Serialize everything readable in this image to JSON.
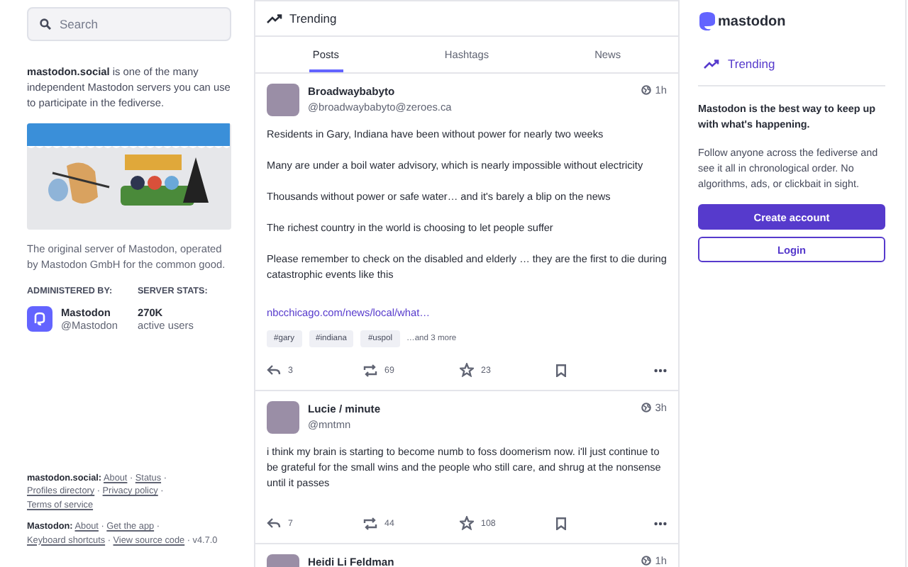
{
  "search": {
    "placeholder": "Search"
  },
  "about": {
    "intro": "**mastodon.social** is one of the many independent Mastodon servers you can use to participate in the fediverse.",
    "description": "The original server of Mastodon, operated by Mastodon GmbH for the common good.",
    "admin_label": "ADMINISTERED BY:",
    "admin": {
      "name": "Mastodon",
      "handle": "@Mastodon"
    },
    "stats_label": "SERVER STATS:",
    "stats": {
      "value": "270K",
      "label": "active users"
    }
  },
  "footer": {
    "separator": "·",
    "groups": [
      {
        "label": "mastodon.social:",
        "links": [
          "About",
          "Status",
          "Profiles directory",
          "Privacy policy",
          "Terms of service"
        ]
      },
      {
        "label": "Mastodon:",
        "links": [
          "About",
          "Get the app",
          "Keyboard shortcuts",
          "View source code"
        ],
        "version": "v4.7.0"
      }
    ]
  },
  "feed": {
    "title": "Trending",
    "tabs": [
      {
        "label": "Posts",
        "selected": true
      },
      {
        "label": "Hashtags",
        "selected": false
      },
      {
        "label": "News",
        "selected": false
      }
    ],
    "posts": [
      {
        "name": "Broadwaybabyto",
        "handle": "@broadwaybabyto@zeroes.ca",
        "time": "1h",
        "paragraphs": [
          "Residents in Gary, Indiana have been without power for nearly two weeks",
          "Many are under a boil water advisory, which is nearly impossible without electricity",
          "Thousands without power or safe water… and it's barely a blip on the news",
          "The richest country in the world is choosing to let people suffer",
          "Please remember to check on the disabled and elderly … they are the first to die during catastrophic events like this"
        ],
        "link": "nbcchicago.com/news/local/what…",
        "tags": [
          "#gary",
          "#indiana",
          "#uspol"
        ],
        "more_tags": "…and 3 more",
        "replies": "3",
        "boosts": "69",
        "favourites": "23"
      },
      {
        "name": "Lucie / minute",
        "handle": "@mntmn",
        "time": "3h",
        "paragraphs": [
          "i think my brain is starting to become numb to foss doomerism now. i'll just continue to be grateful for the small wins and the people who still care, and shrug at the nonsense until it passes"
        ],
        "replies": "7",
        "boosts": "44",
        "favourites": "108"
      },
      {
        "name": "Heidi Li Feldman",
        "time": "1h"
      }
    ]
  },
  "sidebar": {
    "logo": "mastodon",
    "nav": [
      {
        "label": "Trending",
        "selected": true
      }
    ],
    "headline": "Mastodon is the best way to keep up with what's happening.",
    "body": "Follow anyone across the fediverse and see it all in chronological order. No algorithms, ads, or clickbait in sight.",
    "buttons": [
      {
        "label": "Create account",
        "kind": "primary"
      },
      {
        "label": "Login",
        "kind": "outline"
      }
    ]
  }
}
